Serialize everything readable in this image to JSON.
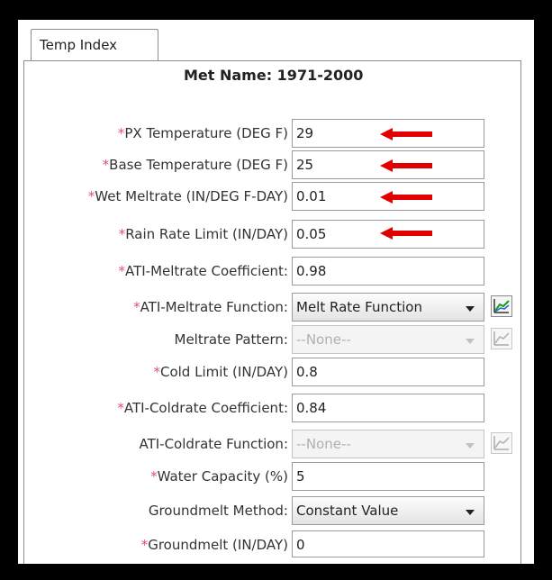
{
  "tab": {
    "label": "Temp Index"
  },
  "met_name": "Met Name: 1971-2000",
  "required_marker": "*",
  "fields": [
    {
      "label": "PX Temperature (DEG F)",
      "value": "29",
      "required": true
    },
    {
      "label": "Base Temperature (DEG F)",
      "value": "25",
      "required": true
    },
    {
      "label": "Wet Meltrate (IN/DEG F-DAY)",
      "value": "0.01",
      "required": true
    },
    {
      "label": "Rain Rate Limit (IN/DAY)",
      "value": "0.05",
      "required": true
    },
    {
      "label": "ATI-Meltrate Coefficient:",
      "value": "0.98",
      "required": true
    },
    {
      "label": "ATI-Meltrate Function:",
      "value": "Melt Rate Function",
      "required": true
    },
    {
      "label": "Meltrate Pattern:",
      "value": "--None--",
      "required": false
    },
    {
      "label": "Cold Limit (IN/DAY)",
      "value": "0.8",
      "required": true
    },
    {
      "label": "ATI-Coldrate Coefficient:",
      "value": "0.84",
      "required": true
    },
    {
      "label": "ATI-Coldrate Function:",
      "value": "--None--",
      "required": false
    },
    {
      "label": "Water Capacity (%)",
      "value": "5",
      "required": true
    },
    {
      "label": "Groundmelt Method:",
      "value": "Constant Value",
      "required": false
    },
    {
      "label": "Groundmelt (IN/DAY)",
      "value": "0",
      "required": true
    }
  ],
  "colors": {
    "required": "#e0507a",
    "arrow": "#e00000"
  }
}
